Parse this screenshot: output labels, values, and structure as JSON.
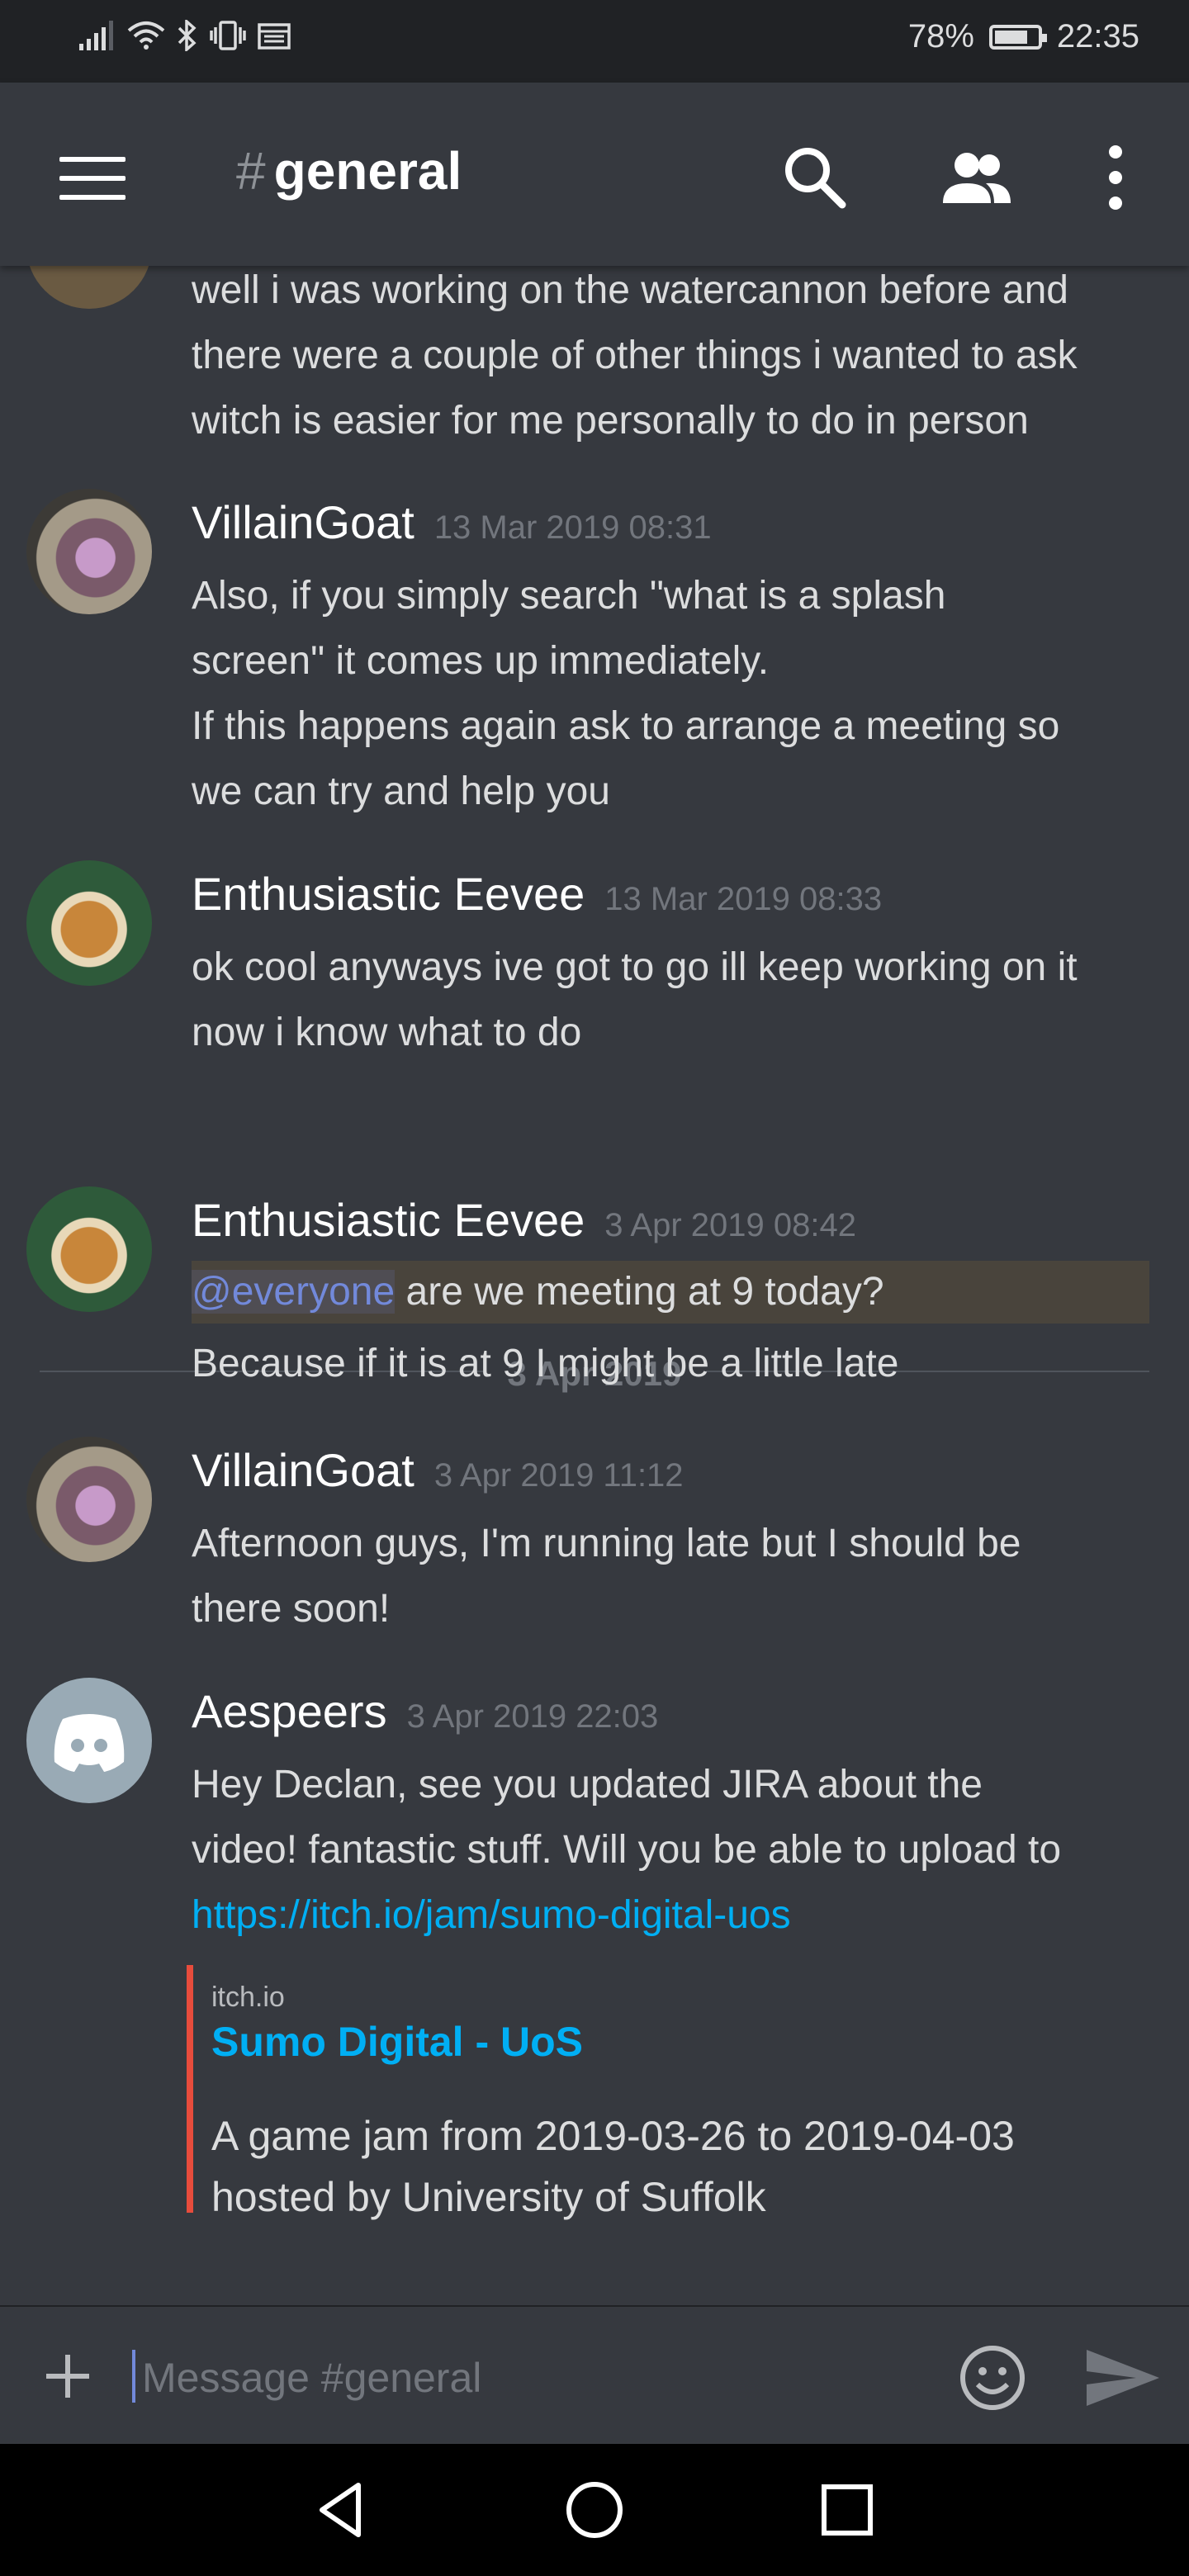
{
  "status_bar": {
    "battery": "78%",
    "battery_level": 0.78,
    "time": "22:35"
  },
  "header": {
    "hash": "#",
    "channel": "general"
  },
  "messages": [
    {
      "author": "",
      "timestamp": "",
      "lines": [
        "well i was working on the watercannon before and",
        "there were a couple of other things i wanted to ask",
        "witch is easier for me personally to do in person"
      ]
    },
    {
      "author": "VillainGoat",
      "timestamp": "13 Mar 2019 08:31",
      "lines": [
        "Also, if you simply search \"what is a splash",
        "screen\" it comes up immediately.",
        "If this happens again ask to arrange a meeting so",
        "we can try and help you"
      ]
    },
    {
      "author": "Enthusiastic Eevee",
      "timestamp": "13 Mar 2019 08:33",
      "lines": [
        "ok cool anyways ive got to go ill keep working on it",
        "now i know what to do"
      ]
    },
    {
      "author": "Enthusiastic Eevee",
      "timestamp": "3 Apr 2019 08:42",
      "mention": "@everyone",
      "lines": [
        " are we meeting at 9 today?",
        "Because if it is at 9 I might be a little late"
      ]
    },
    {
      "author": "VillainGoat",
      "timestamp": "3 Apr 2019 11:12",
      "lines": [
        "Afternoon guys, I'm running late but I should be",
        "there soon!"
      ]
    },
    {
      "author": "Aespeers",
      "timestamp": "3 Apr 2019 22:03",
      "lines": [
        "Hey Declan, see you updated JIRA about the",
        "video! fantastic stuff. Will you be able to upload to"
      ],
      "link": "https://itch.io/jam/sumo-digital-uos"
    }
  ],
  "date_divider": "3 Apr 2019",
  "embed": {
    "provider": "itch.io",
    "title": "Sumo Digital - UoS",
    "description_lines": [
      "A game jam from 2019-03-26 to 2019-04-03",
      "hosted by University of Suffolk"
    ]
  },
  "input": {
    "placeholder": "Message #general"
  },
  "colors": {
    "background": "#36393f",
    "link": "#00aff4",
    "mention": "#7289da",
    "embed_border": "#e74c3c"
  }
}
